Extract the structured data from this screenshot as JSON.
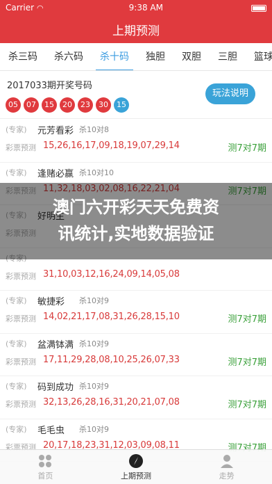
{
  "status_bar": {
    "carrier": "Carrier",
    "time": "9:38 AM"
  },
  "header": {
    "title": "上期预测"
  },
  "tabs": [
    {
      "label": "杀三码"
    },
    {
      "label": "杀六码"
    },
    {
      "label": "杀十码"
    },
    {
      "label": "独胆"
    },
    {
      "label": "双胆"
    },
    {
      "label": "三胆"
    },
    {
      "label": "篮球杀"
    }
  ],
  "active_tab": "杀十码",
  "draw": {
    "period_label": "2017033期开奖号码",
    "numbers": [
      "05",
      "07",
      "15",
      "20",
      "23",
      "30"
    ],
    "special": "15",
    "rule_button": "玩法说明"
  },
  "colors": {
    "brand": "#e03a3e",
    "ball_red": "#e03a3e",
    "ball_blue": "#3aa3d8",
    "accent": "#3a9be0",
    "result_green": "#3aa03a"
  },
  "predictions": [
    {
      "tag": "(专家)",
      "name": "元芳看彩",
      "record": "杀10对8",
      "label": "彩票预测",
      "numbers": "15,26,16,17,09,18,19,07,29,14",
      "result": "测7对7期"
    },
    {
      "tag": "(专家)",
      "name": "逢赌必赢",
      "record": "杀10对10",
      "label": "彩票预测",
      "numbers": "11,32,18,03,02,08,16,22,21,04",
      "result": "测7对7期"
    },
    {
      "tag": "(专家)",
      "name": "好明生",
      "record": "",
      "label": "彩票预测",
      "numbers": "",
      "result": ""
    },
    {
      "tag": "(专家)",
      "name": "",
      "record": "",
      "label": "彩票预测",
      "numbers": "31,10,03,12,16,24,09,14,05,08",
      "result": ""
    },
    {
      "tag": "(专家)",
      "name": "敏捷彩",
      "record": "杀10对9",
      "label": "彩票预测",
      "numbers": "14,02,21,17,08,31,26,28,15,10",
      "result": "测7对7期"
    },
    {
      "tag": "(专家)",
      "name": "盆满钵满",
      "record": "杀10对9",
      "label": "彩票预测",
      "numbers": "17,11,29,28,08,10,25,26,07,33",
      "result": "测7对7期"
    },
    {
      "tag": "(专家)",
      "name": "码到成功",
      "record": "杀10对9",
      "label": "彩票预测",
      "numbers": "32,13,26,28,16,31,20,21,07,08",
      "result": "测7对7期"
    },
    {
      "tag": "(专家)",
      "name": "毛毛虫",
      "record": "杀10对9",
      "label": "彩票预测",
      "numbers": "20,17,18,23,31,12,03,09,08,11",
      "result": "测7对7期"
    }
  ],
  "overlay": {
    "line1": "澳门六开彩天天免费资",
    "line2": "讯统计,实地数据验证"
  },
  "bottom_nav": [
    {
      "label": "首页",
      "icon": "grid-icon"
    },
    {
      "label": "上期预测",
      "icon": "compass-icon"
    },
    {
      "label": "走势",
      "icon": "user-icon"
    }
  ]
}
